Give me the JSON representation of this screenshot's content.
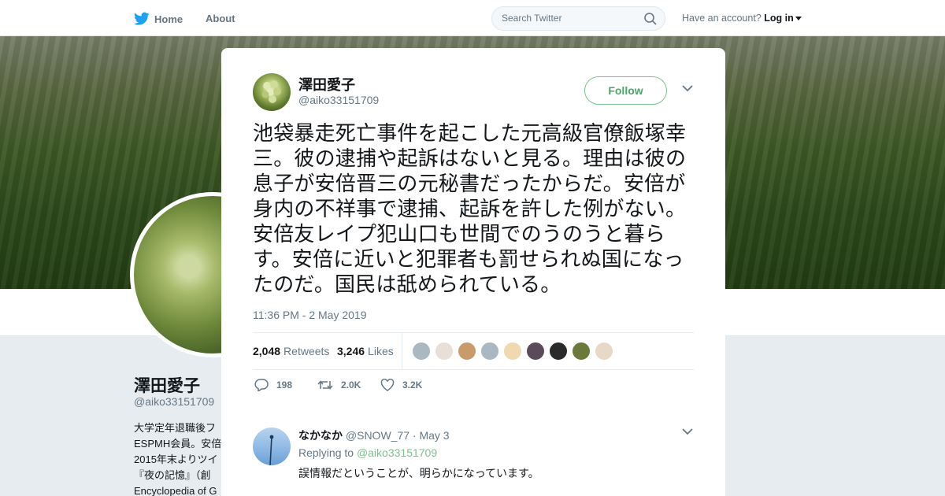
{
  "nav": {
    "home_label": "Home",
    "about_label": "About",
    "search_placeholder": "Search Twitter",
    "account_prompt": "Have an account?",
    "login_label": "Log in"
  },
  "profile": {
    "name": "澤田愛子",
    "handle": "@aiko33151709",
    "bio_lines": [
      "大学定年退職後フ",
      "ESPMH会員。安倍",
      "2015年末よりツイ",
      "『夜の記憶』（創",
      "Encyclopedia of G"
    ]
  },
  "tweet": {
    "author_name": "澤田愛子",
    "author_handle": "@aiko33151709",
    "follow_label": "Follow",
    "text": "池袋暴走死亡事件を起こした元高級官僚飯塚幸三。彼の逮捕や起訴はないと見る。理由は彼の息子が安倍晋三の元秘書だったからだ。安倍が身内の不祥事で逮捕、起訴を許した例がない。安倍友レイプ犯山口も世間でのうのうと暮らす。安倍に近いと犯罪者も罰せられぬ国になったのだ。国民は舐められている。",
    "timestamp": "11:36 PM - 2 May 2019",
    "retweets_count": "2,048",
    "retweets_label": "Retweets",
    "likes_count": "3,246",
    "likes_label": "Likes",
    "reply_count": "198",
    "retweet_count_short": "2.0K",
    "like_count_short": "3.2K"
  },
  "liker_faces": [
    "#aab8c2",
    "#e8e0d8",
    "#c99a6a",
    "#aab8c2",
    "#f0d8b0",
    "#5a4a5a",
    "#2a2a2a",
    "#6b7a3a",
    "#e8d8c8"
  ],
  "reply": {
    "name": "なかなか",
    "handle": "@SNOW_77",
    "date": "· May 3",
    "replying_to_label": "Replying to",
    "replying_to_handle": "@aiko33151709",
    "text": "誤情報だということが、明らかになっています。"
  },
  "colors": {
    "accent_green": "#79c28c",
    "twitter_blue": "#1da1f2",
    "text_secondary": "#657786"
  }
}
